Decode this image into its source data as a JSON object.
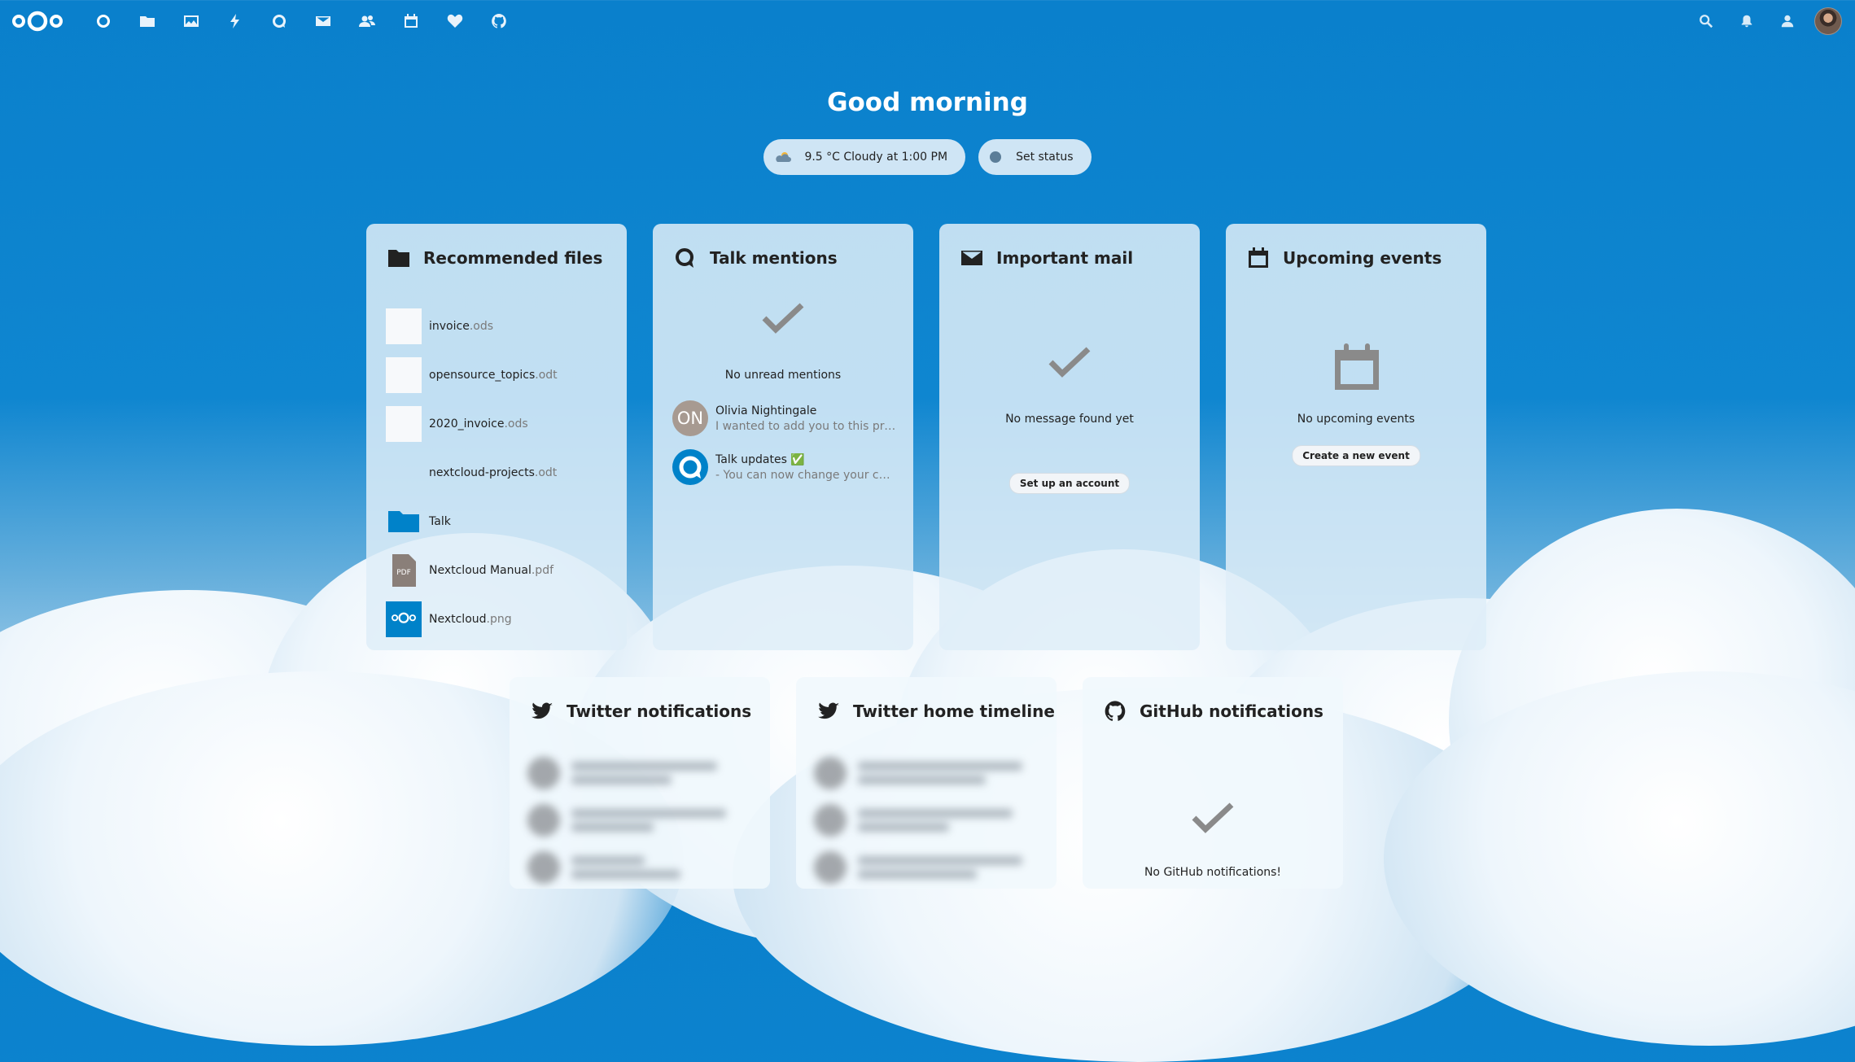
{
  "greeting": "Good morning",
  "weather": {
    "icon": "cloudy-icon",
    "text": "9.5 °C Cloudy at 1:00 PM"
  },
  "status": {
    "label": "Set status"
  },
  "topbar": {
    "apps": [
      {
        "name": "dashboard",
        "icon": "dashboard-icon"
      },
      {
        "name": "files",
        "icon": "folder-icon"
      },
      {
        "name": "photos",
        "icon": "image-icon"
      },
      {
        "name": "activity",
        "icon": "lightning-icon"
      },
      {
        "name": "talk",
        "icon": "talk-icon"
      },
      {
        "name": "mail",
        "icon": "mail-icon"
      },
      {
        "name": "contacts",
        "icon": "contacts-icon"
      },
      {
        "name": "calendar",
        "icon": "calendar-icon"
      },
      {
        "name": "favorites",
        "icon": "heart-icon"
      },
      {
        "name": "github",
        "icon": "github-icon"
      }
    ]
  },
  "widgets": {
    "recommended": {
      "title": "Recommended files",
      "files": [
        {
          "base": "invoice",
          "ext": ".ods"
        },
        {
          "base": "opensource_topics",
          "ext": ".odt"
        },
        {
          "base": "2020_invoice",
          "ext": ".ods"
        },
        {
          "base": "nextcloud-projects",
          "ext": ".odt"
        },
        {
          "base": "Talk",
          "ext": ""
        },
        {
          "base": "Nextcloud Manual",
          "ext": ".pdf"
        },
        {
          "base": "Nextcloud",
          "ext": ".png"
        }
      ],
      "pdf_badge": "PDF"
    },
    "talk": {
      "title": "Talk mentions",
      "empty": "No unread mentions",
      "items": [
        {
          "initials": "ON",
          "name": "Olivia Nightingale",
          "sub": "I wanted to add you to this project..."
        },
        {
          "initials": "",
          "name": "Talk updates ✅",
          "sub": "- You can now change your camera..."
        }
      ]
    },
    "mail": {
      "title": "Important mail",
      "empty": "No message found yet",
      "button": "Set up an account"
    },
    "events": {
      "title": "Upcoming events",
      "empty": "No upcoming events",
      "button": "Create a new event"
    },
    "twitter_notifications": {
      "title": "Twitter notifications"
    },
    "twitter_timeline": {
      "title": "Twitter home timeline"
    },
    "github": {
      "title": "GitHub notifications",
      "empty": "No GitHub notifications!"
    }
  },
  "colors": {
    "brand": "#0082c9",
    "panel": "#dcecf7",
    "text": "#222222"
  }
}
